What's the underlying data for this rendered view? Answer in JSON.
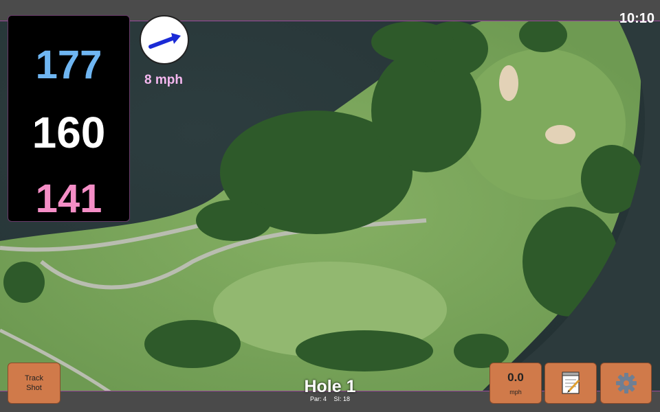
{
  "status": {
    "time": "10:10"
  },
  "distances": {
    "back": "177",
    "middle": "160",
    "front": "141"
  },
  "wind": {
    "speed": "8 mph",
    "icon": "wind-arrow-icon"
  },
  "hole": {
    "title": "Hole 1",
    "par": "Par: 4",
    "si": "SI: 18"
  },
  "buttons": {
    "track_shot": "Track\nShot",
    "speed_value": "0.0",
    "speed_unit": "mph",
    "notes_icon": "notepad-icon",
    "settings_icon": "gear-icon"
  },
  "colors": {
    "back": "#6fb6f2",
    "middle": "#ffffff",
    "front": "#f48ec6",
    "button": "#d07a4a",
    "wind_text": "#f5b8f0"
  }
}
